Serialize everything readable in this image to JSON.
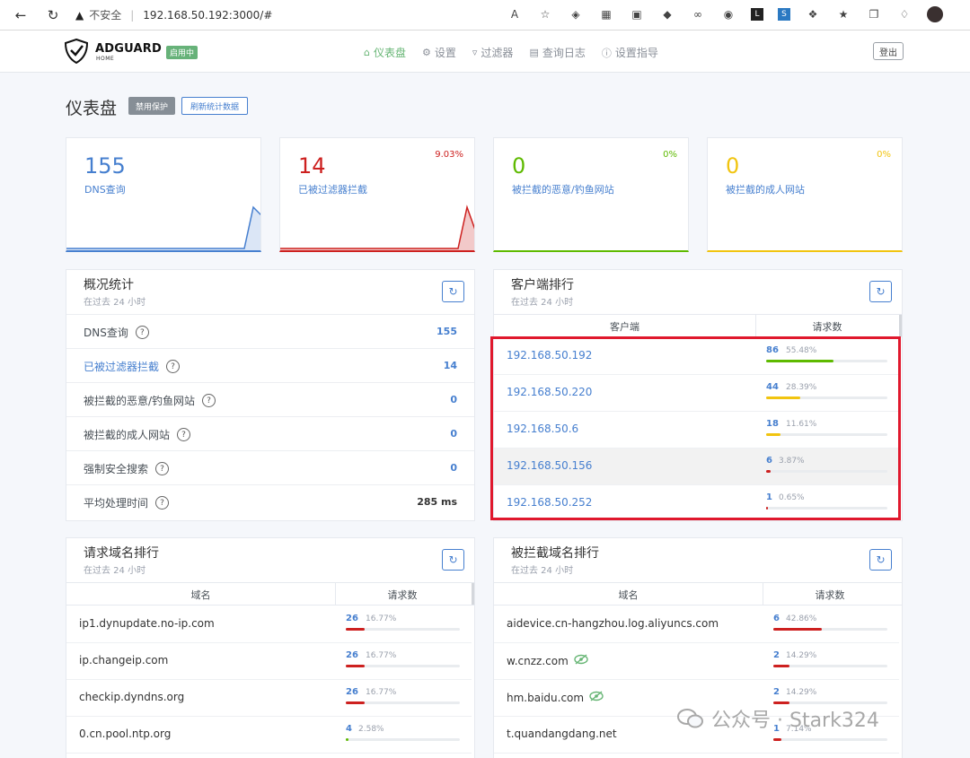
{
  "browser": {
    "back_icon": "back-arrow-icon",
    "reload_icon": "reload-icon",
    "security_label": "不安全",
    "url": "192.168.50.192:3000/#"
  },
  "header": {
    "brand": "ADGUARD",
    "brand_sub": "HOME",
    "status_badge": "启用中",
    "nav": [
      {
        "label": "仪表盘",
        "icon": "home-icon",
        "active": true
      },
      {
        "label": "设置",
        "icon": "gear-icon",
        "active": false
      },
      {
        "label": "过滤器",
        "icon": "filter-icon",
        "active": false
      },
      {
        "label": "查询日志",
        "icon": "log-icon",
        "active": false
      },
      {
        "label": "设置指导",
        "icon": "help-circle-icon",
        "active": false
      }
    ],
    "logout": "登出"
  },
  "page": {
    "title": "仪表盘",
    "disable_button": "禁用保护",
    "refresh_button": "刷新统计数据"
  },
  "stat_cards": [
    {
      "value": "155",
      "label": "DNS查询",
      "percent": "",
      "color": "#467fcf"
    },
    {
      "value": "14",
      "label": "已被过滤器拦截",
      "percent": "9.03%",
      "color": "#cd201f"
    },
    {
      "value": "0",
      "label": "被拦截的恶意/钓鱼网站",
      "percent": "0%",
      "color": "#5eba00"
    },
    {
      "value": "0",
      "label": "被拦截的成人网站",
      "percent": "0%",
      "color": "#f1c40f"
    }
  ],
  "general_stats": {
    "title": "概况统计",
    "subtitle": "在过去 24 小时",
    "rows": [
      {
        "label": "DNS查询",
        "value": "155"
      },
      {
        "label": "已被过滤器拦截",
        "value": "14"
      },
      {
        "label": "被拦截的恶意/钓鱼网站",
        "value": "0"
      },
      {
        "label": "被拦截的成人网站",
        "value": "0"
      },
      {
        "label": "强制安全搜索",
        "value": "0"
      },
      {
        "label": "平均处理时间",
        "value": "285 ms"
      }
    ]
  },
  "top_clients": {
    "title": "客户端排行",
    "subtitle": "在过去 24 小时",
    "col_client": "客户端",
    "col_requests": "请求数",
    "rows": [
      {
        "name": "192.168.50.192",
        "count": "86",
        "percent": "55.48%",
        "fraction": 0.5548,
        "color": "#5eba00"
      },
      {
        "name": "192.168.50.220",
        "count": "44",
        "percent": "28.39%",
        "fraction": 0.2839,
        "color": "#f1c40f"
      },
      {
        "name": "192.168.50.6",
        "count": "18",
        "percent": "11.61%",
        "fraction": 0.1161,
        "color": "#f1c40f"
      },
      {
        "name": "192.168.50.156",
        "count": "6",
        "percent": "3.87%",
        "fraction": 0.0387,
        "color": "#cd201f"
      },
      {
        "name": "192.168.50.252",
        "count": "1",
        "percent": "0.65%",
        "fraction": 0.0065,
        "color": "#cd201f"
      }
    ]
  },
  "top_queried": {
    "title": "请求域名排行",
    "subtitle": "在过去 24 小时",
    "col_domain": "域名",
    "col_requests": "请求数",
    "rows": [
      {
        "name": "ip1.dynupdate.no-ip.com",
        "count": "26",
        "percent": "16.77%",
        "fraction": 0.1677,
        "color": "#cd201f"
      },
      {
        "name": "ip.changeip.com",
        "count": "26",
        "percent": "16.77%",
        "fraction": 0.1677,
        "color": "#cd201f"
      },
      {
        "name": "checkip.dyndns.org",
        "count": "26",
        "percent": "16.77%",
        "fraction": 0.1677,
        "color": "#cd201f"
      },
      {
        "name": "0.cn.pool.ntp.org",
        "count": "4",
        "percent": "2.58%",
        "fraction": 0.0258,
        "color": "#5eba00"
      }
    ]
  },
  "top_blocked": {
    "title": "被拦截域名排行",
    "subtitle": "在过去 24 小时",
    "col_domain": "域名",
    "col_requests": "请求数",
    "rows": [
      {
        "name": "aidevice.cn-hangzhou.log.aliyuncs.com",
        "count": "6",
        "percent": "42.86%",
        "fraction": 0.4286,
        "color": "#cd201f",
        "eye": false
      },
      {
        "name": "w.cnzz.com",
        "count": "2",
        "percent": "14.29%",
        "fraction": 0.1429,
        "color": "#cd201f",
        "eye": true
      },
      {
        "name": "hm.baidu.com",
        "count": "2",
        "percent": "14.29%",
        "fraction": 0.1429,
        "color": "#cd201f",
        "eye": true
      },
      {
        "name": "t.quandangdang.net",
        "count": "1",
        "percent": "7.14%",
        "fraction": 0.0714,
        "color": "#cd201f",
        "eye": false
      }
    ]
  },
  "watermark": {
    "text": "公众号 · Stark324"
  }
}
